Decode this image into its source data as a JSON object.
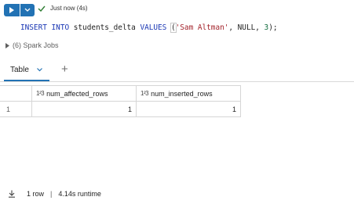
{
  "cell": {
    "status": "Just now (4s)",
    "code": {
      "kw1": "INSERT",
      "kw2": "INTO",
      "table": "students_delta",
      "kw3": "VALUES",
      "open_paren": "(",
      "str_value": "'Sam Altman'",
      "null_part": ", NULL, ",
      "num_value": "3",
      "close": ");"
    },
    "spark_jobs": "(6) Spark Jobs"
  },
  "tabs": {
    "table_label": "Table",
    "add_label": "+"
  },
  "results": {
    "columns": [
      {
        "type_icon": "1²3",
        "name": "num_affected_rows"
      },
      {
        "type_icon": "1²3",
        "name": "num_inserted_rows"
      }
    ],
    "rows": [
      {
        "index": "1",
        "values": [
          "1",
          "1"
        ]
      }
    ]
  },
  "footer": {
    "rows": "1 row",
    "separator": "|",
    "runtime": "4.14s runtime"
  },
  "colors": {
    "accent": "#2272b4",
    "success": "#2e7d32"
  }
}
